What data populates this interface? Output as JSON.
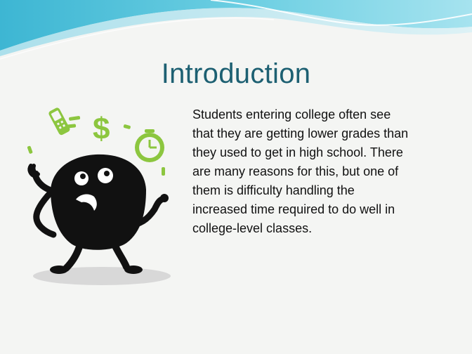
{
  "slide": {
    "title": "Introduction",
    "body_lines": [
      "Students entering college often see",
      "that they are getting lower grades than",
      "they used to get in high school.  There",
      "are many reasons for this, but one of",
      "them is difficulty handling the",
      "increased time required to do well in",
      "college-level classes."
    ],
    "dollar_glyph": "$"
  },
  "colors": {
    "title": "#1d6072",
    "accent_green": "#8cc63f",
    "wave_blue": "#5fc6dc"
  },
  "icons": [
    "cellphone-icon",
    "dollar-sign-icon",
    "clock-icon",
    "stressed-character-illustration"
  ]
}
